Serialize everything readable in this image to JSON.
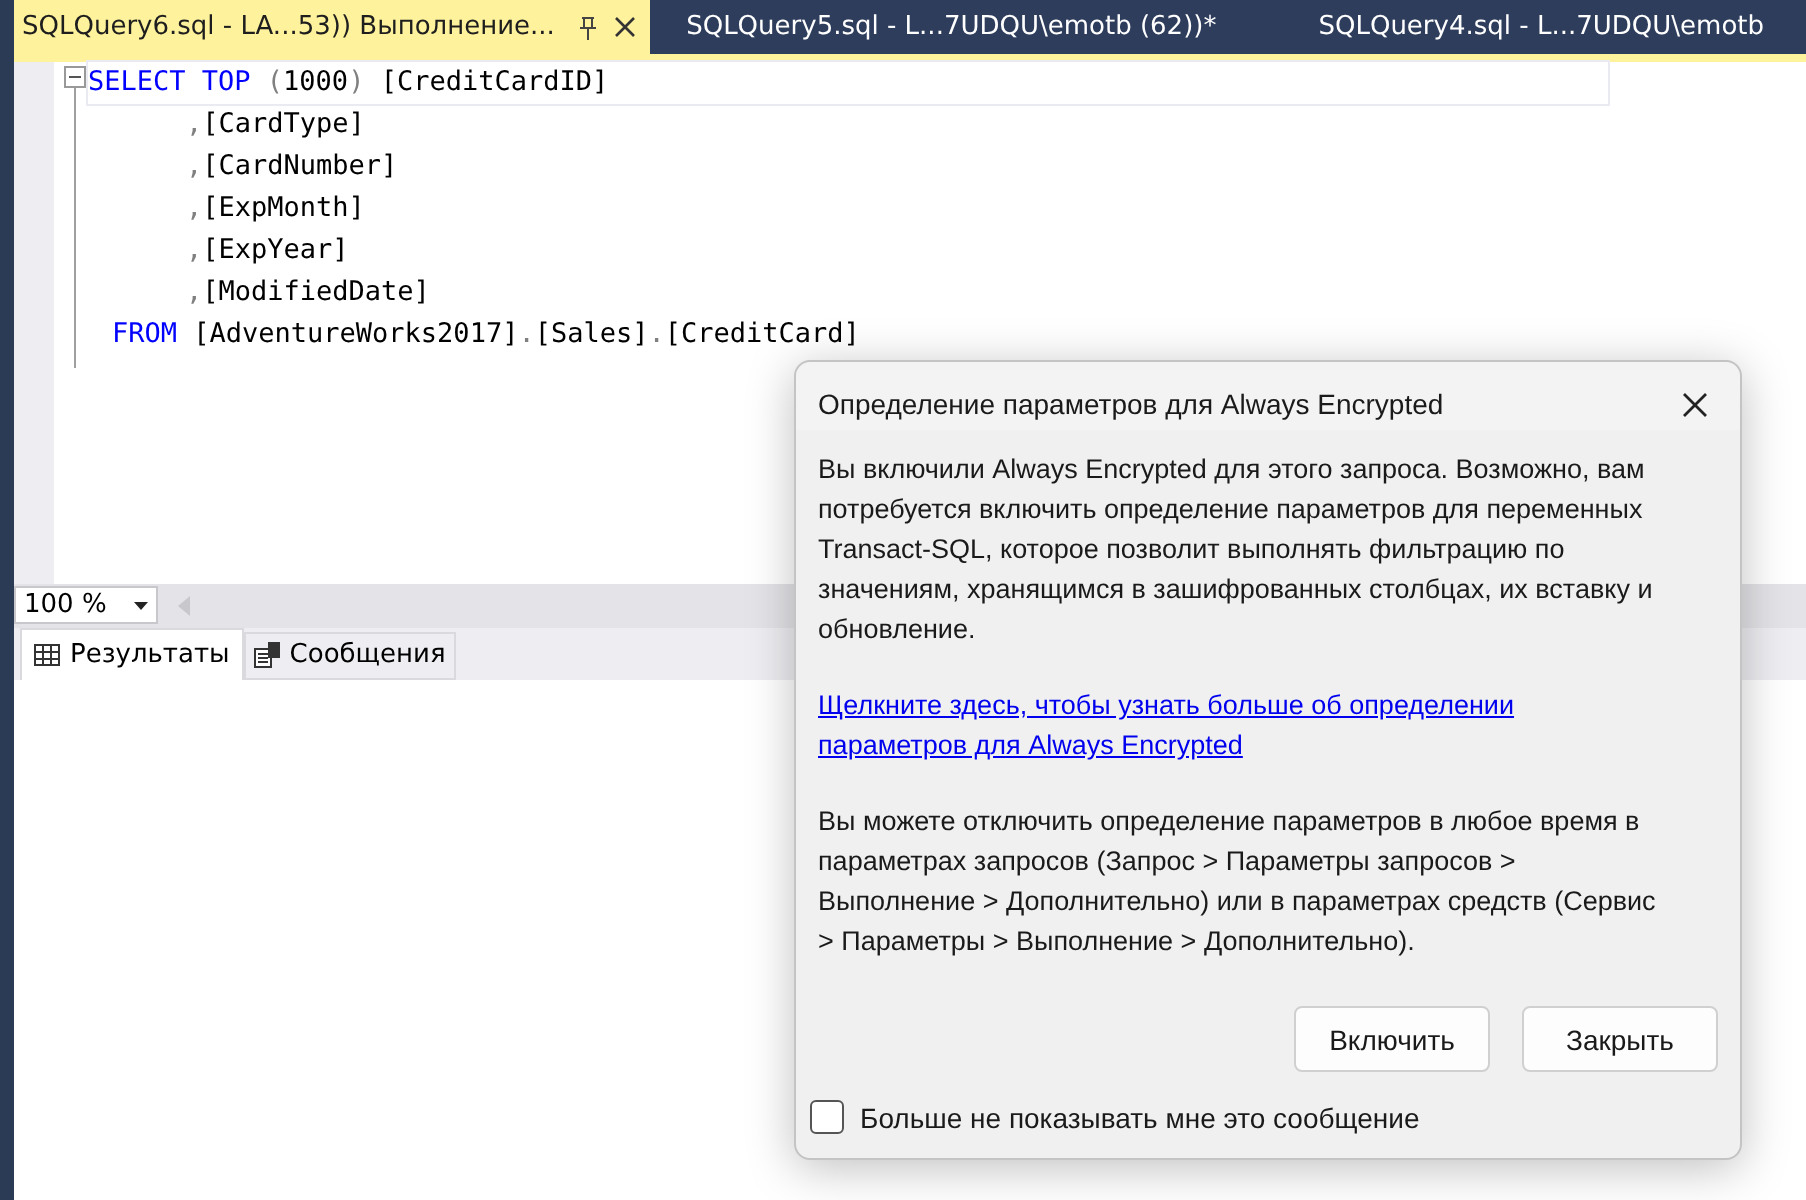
{
  "tabs": [
    {
      "label": "SQLQuery6.sql - LA...53)) Выполнение...",
      "selected": true
    },
    {
      "label": "SQLQuery5.sql - L...7UDQU\\emotb (62))*",
      "selected": false
    },
    {
      "label": "SQLQuery4.sql - L...7UDQU\\emotb",
      "selected": false
    }
  ],
  "editor": {
    "fold_expanded": true,
    "lines": [
      {
        "kind": "statement",
        "tokens": [
          {
            "kind": "keyword",
            "text": "SELECT TOP"
          },
          {
            "kind": "gray",
            "text": " ("
          },
          {
            "kind": "text",
            "text": "1000"
          },
          {
            "kind": "gray",
            "text": ")"
          },
          {
            "kind": "text",
            "text": " [CreditCardID]"
          }
        ]
      },
      {
        "kind": "column",
        "tokens": [
          {
            "kind": "gray",
            "text": ","
          },
          {
            "kind": "text",
            "text": "[CardType]"
          }
        ]
      },
      {
        "kind": "column",
        "tokens": [
          {
            "kind": "gray",
            "text": ","
          },
          {
            "kind": "text",
            "text": "[CardNumber]"
          }
        ]
      },
      {
        "kind": "column",
        "tokens": [
          {
            "kind": "gray",
            "text": ","
          },
          {
            "kind": "text",
            "text": "[ExpMonth]"
          }
        ]
      },
      {
        "kind": "column",
        "tokens": [
          {
            "kind": "gray",
            "text": ","
          },
          {
            "kind": "text",
            "text": "[ExpYear]"
          }
        ]
      },
      {
        "kind": "column",
        "tokens": [
          {
            "kind": "gray",
            "text": ","
          },
          {
            "kind": "text",
            "text": "[ModifiedDate]"
          }
        ]
      },
      {
        "kind": "clause",
        "tokens": [
          {
            "kind": "keyword",
            "text": "FROM"
          },
          {
            "kind": "text",
            "text": " [AdventureWorks2017]"
          },
          {
            "kind": "gray",
            "text": "."
          },
          {
            "kind": "text",
            "text": "[Sales]"
          },
          {
            "kind": "gray",
            "text": "."
          },
          {
            "kind": "text",
            "text": "[CreditCard]"
          }
        ]
      }
    ]
  },
  "zoom": {
    "value": "100 %"
  },
  "result_tabs": [
    {
      "label": "Результаты",
      "selected": true
    },
    {
      "label": "Сообщения",
      "selected": false
    }
  ],
  "dialog": {
    "title": "Определение параметров для Always Encrypted",
    "text1": "Вы включили Always Encrypted для этого запроса. Возможно, вам потребуется включить определение параметров для переменных Transact-SQL, которое позволит выполнять фильтрацию по значениям, хранящимся в зашифрованных столбцах, их вставку и обновление.",
    "link": "Щелкните здесь, чтобы узнать больше об определении параметров для Always Encrypted",
    "text2": "Вы можете отключить определение параметров в любое время в параметрах запросов (Запрос > Параметры запросов > Выполнение > Дополнительно) или в параметрах средств (Сервис > Параметры > Выполнение > Дополнительно).",
    "buttons": [
      "Включить",
      "Закрыть"
    ],
    "checkbox": {
      "label": "Больше не показывать мне это сообщение",
      "checked": false
    }
  }
}
